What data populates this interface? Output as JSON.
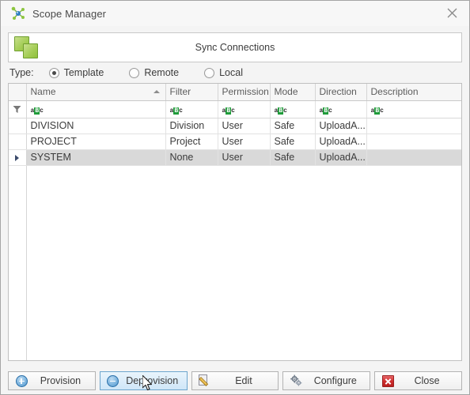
{
  "window": {
    "title": "Scope Manager",
    "title_icon": "scope-network-icon",
    "close_icon": "close-icon"
  },
  "sync_bar": {
    "label": "Sync Connections",
    "icon": "two-green-squares-icon"
  },
  "type_selector": {
    "label": "Type:",
    "options": [
      {
        "label": "Template",
        "selected": true
      },
      {
        "label": "Remote",
        "selected": false
      },
      {
        "label": "Local",
        "selected": false
      }
    ]
  },
  "grid": {
    "columns": [
      {
        "key": "name",
        "label": "Name",
        "sorted": "asc"
      },
      {
        "key": "filter",
        "label": "Filter"
      },
      {
        "key": "permission",
        "label": "Permission"
      },
      {
        "key": "mode",
        "label": "Mode"
      },
      {
        "key": "direction",
        "label": "Direction"
      },
      {
        "key": "description",
        "label": "Description"
      }
    ],
    "filter_row": {
      "funnel_icon": "filter-funnel-icon",
      "cells": [
        "aBc",
        "aBc",
        "aBc",
        "aBc",
        "aBc",
        "aBc"
      ]
    },
    "rows": [
      {
        "name": "DIVISION",
        "filter": "Division",
        "permission": "User",
        "mode": "Safe",
        "direction": "UploadA...",
        "description": "",
        "selected": false
      },
      {
        "name": "PROJECT",
        "filter": "Project",
        "permission": "User",
        "mode": "Safe",
        "direction": "UploadA...",
        "description": "",
        "selected": false
      },
      {
        "name": "SYSTEM",
        "filter": "None",
        "permission": "User",
        "mode": "Safe",
        "direction": "UploadA...",
        "description": "",
        "selected": true
      }
    ]
  },
  "footer": {
    "buttons": [
      {
        "label": "Provision",
        "icon": "plus-circle-icon",
        "hovered": false
      },
      {
        "label": "Deprovision",
        "icon": "minus-circle-icon",
        "hovered": true
      },
      {
        "label": "Edit",
        "icon": "pencil-page-icon",
        "hovered": false
      },
      {
        "label": "Configure",
        "icon": "gears-icon",
        "hovered": false
      },
      {
        "label": "Close",
        "icon": "red-x-icon",
        "hovered": false
      }
    ]
  },
  "colors": {
    "accent_green": "#a3cc54",
    "filter_highlight": "#1f9c3a",
    "hover_blue": "#cfe6f8",
    "selection_gray": "#d9d9d9",
    "close_red": "#cf2d2d"
  }
}
